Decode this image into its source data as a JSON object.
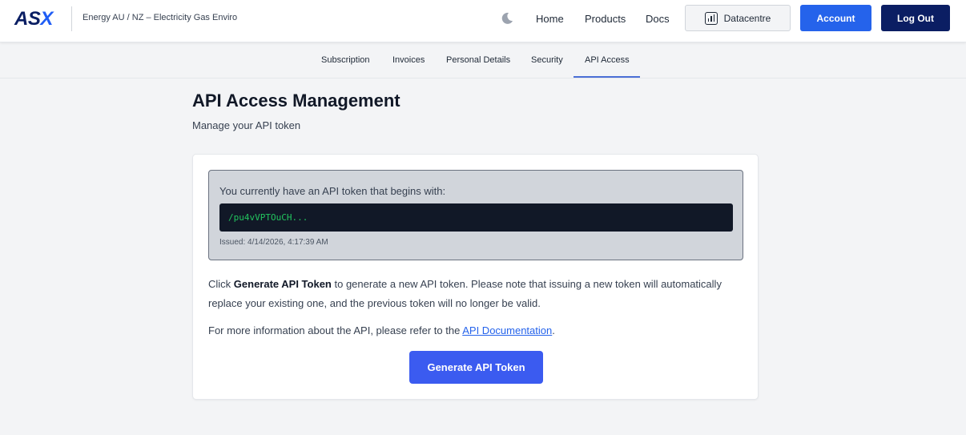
{
  "header": {
    "logo_main": "AS",
    "logo_accent": "X",
    "app_name": "Energy AU / NZ – Electricity Gas Enviro",
    "theme_toggle_icon": "moon-icon",
    "nav": {
      "home": "Home",
      "products": "Products",
      "docs": "Docs"
    },
    "datacentre_label": "Datacentre",
    "datacentre_icon": "bar-chart-icon",
    "account_label": "Account",
    "logout_label": "Log Out"
  },
  "tabs": [
    {
      "label": "Subscription"
    },
    {
      "label": "Invoices"
    },
    {
      "label": "Personal Details"
    },
    {
      "label": "Security"
    },
    {
      "label": "API Access",
      "active": true
    }
  ],
  "page": {
    "title": "API Access Management",
    "subtitle": "Manage your API token"
  },
  "token": {
    "intro": "You currently have an API token that begins with:",
    "prefix": "/pu4vVPTOuCH...",
    "issued": "Issued: 4/14/2026, 4:17:39 AM"
  },
  "info": {
    "p1_before": "Click ",
    "p1_bold": "Generate API Token",
    "p1_after": " to generate a new API token. Please note that issuing a new token will automatically replace your existing one, and the previous token will no longer be valid.",
    "p2_before": "For more information about the API, please refer to the ",
    "p2_link": "API Documentation",
    "p2_after": "."
  },
  "generate_button": "Generate API Token",
  "colors": {
    "primary": "#2563eb",
    "navy": "#0b1e63",
    "token_text": "#22c55e",
    "background": "#f3f4f6"
  }
}
